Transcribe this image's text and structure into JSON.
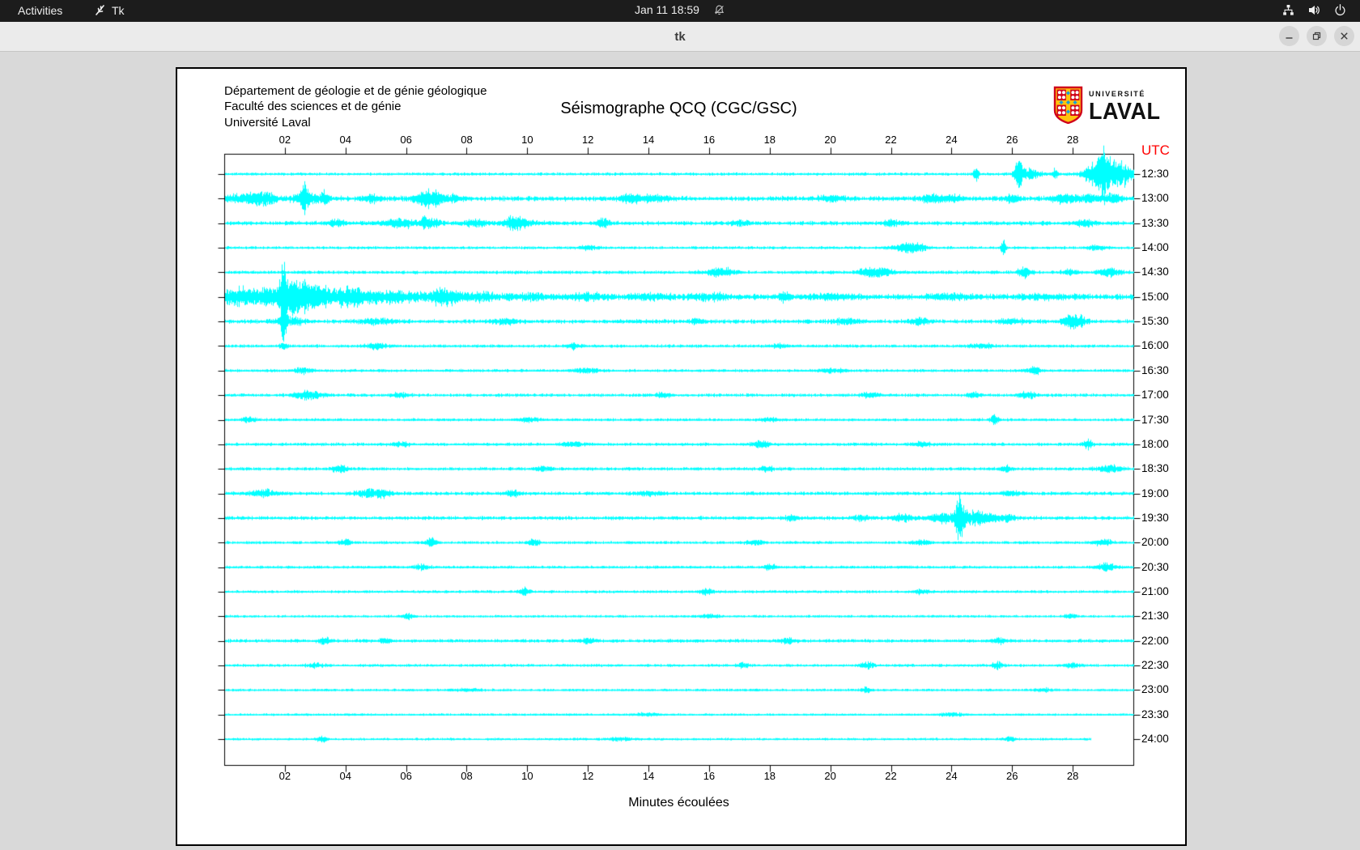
{
  "desktop": {
    "topbar": {
      "activities": "Activities",
      "app": "Tk",
      "clock": "Jan 11  18:59"
    }
  },
  "window": {
    "title": "tk"
  },
  "header": {
    "line1": "Département de géologie et de génie géologique",
    "line2": "Faculté des sciences et de génie",
    "line3": "Université Laval"
  },
  "title": "Séismographe QCQ (CGC/GSC)",
  "logo": {
    "small": "UNIVERSITÉ",
    "large": "LAVAL"
  },
  "axis": {
    "utc": "UTC",
    "xlabel": "Minutes écoulées",
    "minutes_range": [
      0,
      30
    ],
    "minute_ticks": [
      "02",
      "04",
      "06",
      "08",
      "10",
      "12",
      "14",
      "16",
      "18",
      "20",
      "22",
      "24",
      "26",
      "28"
    ]
  },
  "colors": {
    "trace": "#00ffff",
    "utc_red": "#ff0000",
    "topbar_bg": "#1c1c1c",
    "titlebar_bg": "#ebebeb",
    "body_bg": "#d9d9d9",
    "logo_red": "#d0021b",
    "logo_gold": "#ffc20e",
    "logo_blue": "#1a9dd9"
  },
  "helicorder": {
    "seed": 11,
    "row_spacing_px": 30.35,
    "rows": [
      {
        "label": "12:30",
        "base": 1.6,
        "end": 30,
        "events": [
          [
            24.8,
            12,
            0.06
          ],
          [
            26.2,
            18,
            0.08
          ],
          [
            26.5,
            6,
            0.3
          ],
          [
            27.4,
            7,
            0.06
          ],
          [
            28.9,
            16,
            0.35
          ],
          [
            29.0,
            20,
            0.06
          ],
          [
            29.5,
            14,
            0.4
          ]
        ]
      },
      {
        "label": "13:00",
        "base": 2.6,
        "end": 30,
        "events": [
          [
            0.7,
            4,
            0.5
          ],
          [
            1.3,
            6,
            0.3
          ],
          [
            2.64,
            16,
            0.07
          ],
          [
            2.8,
            6,
            0.4
          ],
          [
            3.3,
            8,
            0.08
          ],
          [
            4.9,
            5,
            0.2
          ],
          [
            6.6,
            9,
            0.25
          ],
          [
            7.0,
            7,
            0.15
          ],
          [
            7.5,
            4,
            0.2
          ],
          [
            13.4,
            4,
            0.3
          ],
          [
            14.1,
            3,
            0.4
          ],
          [
            20,
            3,
            0.3
          ],
          [
            23.3,
            4,
            0.25
          ],
          [
            24,
            3,
            0.3
          ],
          [
            26,
            4,
            0.2
          ],
          [
            27.7,
            5,
            0.3
          ],
          [
            28.5,
            4,
            0.3
          ],
          [
            29.3,
            5,
            0.2
          ]
        ]
      },
      {
        "label": "13:30",
        "base": 2.2,
        "end": 30,
        "events": [
          [
            3.7,
            4,
            0.2
          ],
          [
            5.8,
            5,
            0.4
          ],
          [
            6.6,
            7,
            0.1
          ],
          [
            6.9,
            5,
            0.15
          ],
          [
            8.3,
            4,
            0.3
          ],
          [
            9.5,
            7,
            0.2
          ],
          [
            9.9,
            4,
            0.3
          ],
          [
            12.4,
            5,
            0.12
          ],
          [
            12.6,
            4,
            0.1
          ],
          [
            17,
            3,
            0.2
          ],
          [
            22,
            3,
            0.2
          ],
          [
            28.4,
            4,
            0.2
          ]
        ]
      },
      {
        "label": "14:00",
        "base": 1.5,
        "end": 30,
        "events": [
          [
            12,
            3,
            0.2
          ],
          [
            22.5,
            5,
            0.3
          ],
          [
            22.9,
            4,
            0.2
          ],
          [
            25.7,
            12,
            0.05
          ],
          [
            28.8,
            3,
            0.2
          ]
        ]
      },
      {
        "label": "14:30",
        "base": 1.8,
        "end": 30,
        "events": [
          [
            16.2,
            4,
            0.3
          ],
          [
            16.6,
            3,
            0.2
          ],
          [
            21.3,
            5,
            0.3
          ],
          [
            21.8,
            4,
            0.25
          ],
          [
            26.4,
            6,
            0.15
          ],
          [
            27.9,
            3,
            0.2
          ],
          [
            29.2,
            6,
            0.25
          ]
        ]
      },
      {
        "label": "15:00",
        "base": 3.0,
        "end": 30,
        "events": [
          [
            0.3,
            8,
            0.3
          ],
          [
            0.8,
            7,
            0.3
          ],
          [
            1.3,
            9,
            0.2
          ],
          [
            1.7,
            10,
            0.15
          ],
          [
            1.95,
            55,
            0.07
          ],
          [
            2.2,
            22,
            0.15
          ],
          [
            2.5,
            14,
            0.2
          ],
          [
            2.9,
            12,
            0.25
          ],
          [
            3.4,
            9,
            0.3
          ],
          [
            4.0,
            10,
            0.2
          ],
          [
            4.35,
            12,
            0.08
          ],
          [
            4.8,
            7,
            0.3
          ],
          [
            5.5,
            6,
            0.3
          ],
          [
            6.3,
            5,
            0.3
          ],
          [
            7.1,
            9,
            0.2
          ],
          [
            7.5,
            6,
            0.3
          ],
          [
            8.5,
            4,
            0.4
          ],
          [
            10,
            3.5,
            0.5
          ],
          [
            12,
            3,
            0.5
          ],
          [
            14,
            3,
            0.5
          ],
          [
            16,
            3,
            0.5
          ],
          [
            18.5,
            5,
            0.15
          ],
          [
            20,
            2.5,
            0.5
          ],
          [
            24,
            2.5,
            0.5
          ],
          [
            27,
            2.5,
            0.5
          ]
        ]
      },
      {
        "label": "15:30",
        "base": 2.2,
        "end": 30,
        "events": [
          [
            1.95,
            30,
            0.05
          ],
          [
            2.1,
            6,
            0.3
          ],
          [
            5,
            3,
            0.4
          ],
          [
            9.3,
            3,
            0.3
          ],
          [
            15.6,
            4,
            0.15
          ],
          [
            20.5,
            3,
            0.3
          ],
          [
            22.9,
            4,
            0.2
          ],
          [
            26,
            3,
            0.3
          ],
          [
            27.9,
            7,
            0.2
          ],
          [
            28.2,
            5,
            0.2
          ]
        ]
      },
      {
        "label": "16:00",
        "base": 1.6,
        "end": 30,
        "events": [
          [
            1.95,
            4,
            0.1
          ],
          [
            5,
            3,
            0.3
          ],
          [
            11.5,
            4,
            0.15
          ],
          [
            18.3,
            3,
            0.2
          ],
          [
            25,
            2.5,
            0.3
          ]
        ]
      },
      {
        "label": "16:30",
        "base": 1.5,
        "end": 30,
        "events": [
          [
            2.6,
            4,
            0.2
          ],
          [
            12,
            2.5,
            0.3
          ],
          [
            20,
            2.5,
            0.3
          ],
          [
            26.7,
            5,
            0.15
          ]
        ]
      },
      {
        "label": "17:00",
        "base": 1.7,
        "end": 30,
        "events": [
          [
            2.6,
            4,
            0.3
          ],
          [
            3.0,
            3,
            0.2
          ],
          [
            5.8,
            3,
            0.2
          ],
          [
            14.5,
            3,
            0.2
          ],
          [
            21.3,
            3,
            0.2
          ],
          [
            24.7,
            3.5,
            0.15
          ],
          [
            26.5,
            4,
            0.2
          ]
        ]
      },
      {
        "label": "17:30",
        "base": 1.5,
        "end": 30,
        "events": [
          [
            0.8,
            4,
            0.15
          ],
          [
            10,
            2.5,
            0.3
          ],
          [
            18,
            2.5,
            0.2
          ],
          [
            25.4,
            6,
            0.1
          ]
        ]
      },
      {
        "label": "18:00",
        "base": 1.7,
        "end": 30,
        "events": [
          [
            5.8,
            3,
            0.2
          ],
          [
            11.5,
            3,
            0.25
          ],
          [
            17.7,
            4,
            0.2
          ],
          [
            23,
            3,
            0.2
          ],
          [
            28.5,
            6,
            0.1
          ]
        ]
      },
      {
        "label": "18:30",
        "base": 1.7,
        "end": 30,
        "events": [
          [
            3.8,
            4,
            0.2
          ],
          [
            10.5,
            3,
            0.2
          ],
          [
            17.9,
            3.5,
            0.15
          ],
          [
            25.8,
            4,
            0.12
          ],
          [
            29.2,
            4,
            0.3
          ]
        ]
      },
      {
        "label": "19:00",
        "base": 1.9,
        "end": 30,
        "events": [
          [
            1.3,
            5,
            0.3
          ],
          [
            4.7,
            4,
            0.3
          ],
          [
            5.2,
            4,
            0.2
          ],
          [
            9.5,
            3,
            0.2
          ],
          [
            14,
            2.5,
            0.3
          ],
          [
            26,
            3,
            0.2
          ]
        ]
      },
      {
        "label": "19:30",
        "base": 1.9,
        "end": 30,
        "events": [
          [
            18.7,
            3,
            0.2
          ],
          [
            21,
            3,
            0.2
          ],
          [
            22.4,
            4,
            0.25
          ],
          [
            23.7,
            6,
            0.3
          ],
          [
            24.25,
            30,
            0.09
          ],
          [
            24.6,
            9,
            0.3
          ],
          [
            25.2,
            5,
            0.3
          ],
          [
            25.9,
            4,
            0.15
          ]
        ]
      },
      {
        "label": "20:00",
        "base": 1.5,
        "end": 30,
        "events": [
          [
            4,
            4,
            0.15
          ],
          [
            6.8,
            5,
            0.12
          ],
          [
            10.2,
            5,
            0.12
          ],
          [
            17.5,
            3,
            0.2
          ],
          [
            23,
            3,
            0.2
          ],
          [
            29,
            4,
            0.2
          ]
        ]
      },
      {
        "label": "20:30",
        "base": 1.5,
        "end": 30,
        "events": [
          [
            6.5,
            3,
            0.2
          ],
          [
            18,
            4,
            0.15
          ],
          [
            29.1,
            5,
            0.2
          ]
        ]
      },
      {
        "label": "21:00",
        "base": 1.5,
        "end": 30,
        "events": [
          [
            9.9,
            5,
            0.12
          ],
          [
            15.9,
            4,
            0.15
          ],
          [
            23,
            2.5,
            0.2
          ]
        ]
      },
      {
        "label": "21:30",
        "base": 1.3,
        "end": 30,
        "events": [
          [
            6.1,
            4,
            0.12
          ],
          [
            16,
            2.5,
            0.2
          ],
          [
            27.9,
            3,
            0.15
          ]
        ]
      },
      {
        "label": "22:00",
        "base": 1.8,
        "end": 30,
        "events": [
          [
            3.3,
            4,
            0.15
          ],
          [
            5.3,
            4,
            0.12
          ],
          [
            12,
            2.5,
            0.2
          ],
          [
            18.6,
            4,
            0.15
          ],
          [
            25.6,
            3,
            0.15
          ]
        ]
      },
      {
        "label": "22:30",
        "base": 1.5,
        "end": 30,
        "events": [
          [
            3,
            2.5,
            0.2
          ],
          [
            17.1,
            4,
            0.12
          ],
          [
            21.2,
            4,
            0.15
          ],
          [
            25.5,
            5,
            0.12
          ],
          [
            28,
            2.5,
            0.2
          ]
        ]
      },
      {
        "label": "23:00",
        "base": 1.3,
        "end": 30,
        "events": [
          [
            8,
            2,
            0.3
          ],
          [
            21.2,
            3.5,
            0.12
          ],
          [
            27,
            2,
            0.2
          ]
        ]
      },
      {
        "label": "23:30",
        "base": 1.2,
        "end": 30,
        "events": [
          [
            14,
            2,
            0.3
          ],
          [
            24,
            2,
            0.3
          ]
        ]
      },
      {
        "label": "24:00",
        "base": 1.3,
        "end": 28.6,
        "events": [
          [
            3.2,
            3.5,
            0.12
          ],
          [
            13,
            2,
            0.3
          ],
          [
            25.9,
            3.5,
            0.12
          ]
        ]
      }
    ]
  }
}
